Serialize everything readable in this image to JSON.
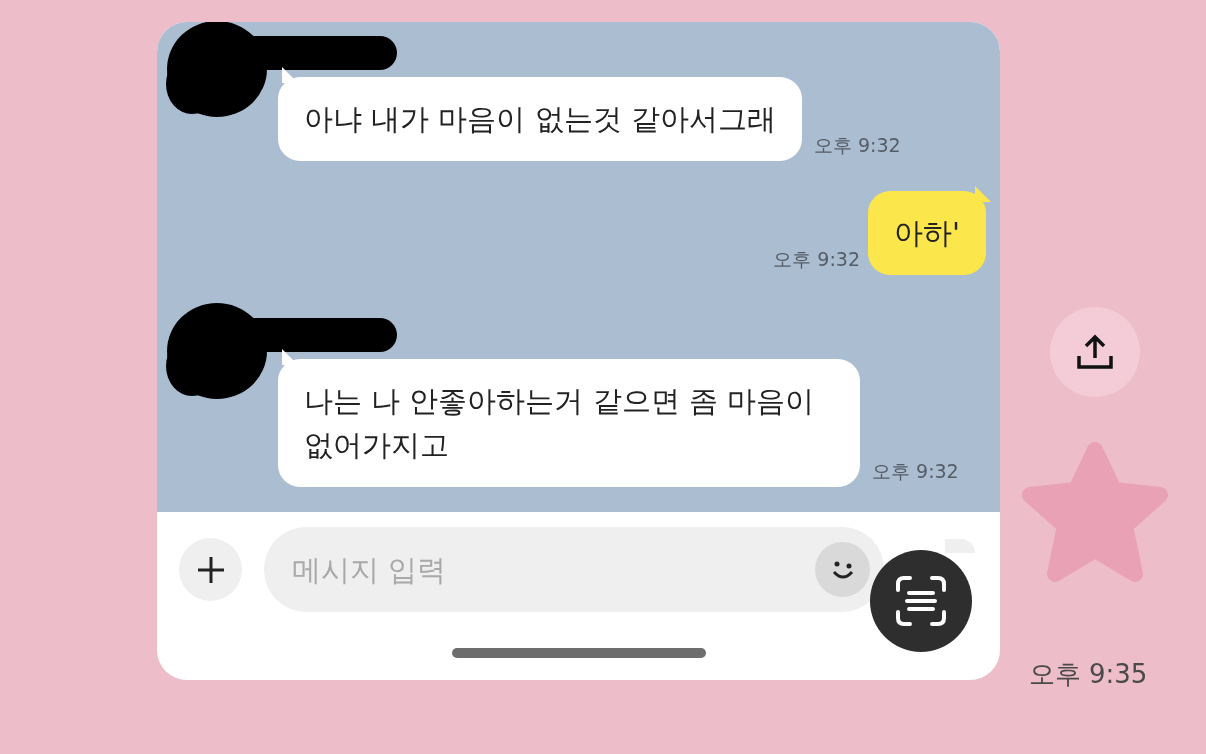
{
  "chat": {
    "messages": [
      {
        "kind": "received",
        "text": "아냐 내가 마음이 없는것 같아서그래",
        "time": "오후 9:32"
      },
      {
        "kind": "sent",
        "text": "아하'",
        "time": "오후 9:32"
      },
      {
        "kind": "received",
        "text": "나는 나 안좋아하는거 같으면 좀 마음이 없어가지고",
        "time": "오후 9:32"
      }
    ]
  },
  "input": {
    "placeholder": "메시지 입력"
  },
  "shared_time": "오후 9:35"
}
